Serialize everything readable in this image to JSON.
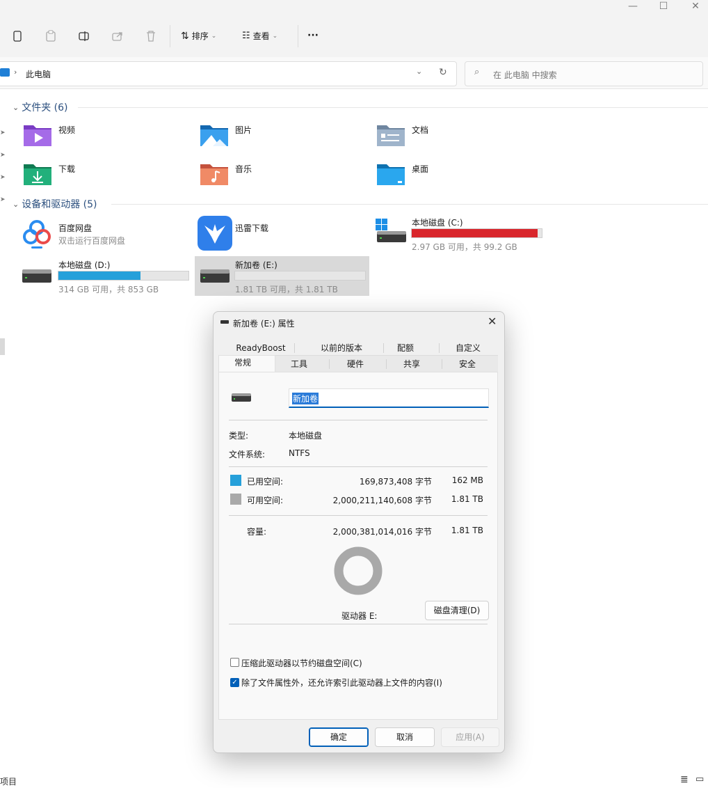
{
  "window": {
    "minimize": "—",
    "maximize": "☐",
    "close": "✕"
  },
  "toolbar": {
    "sort_label": "排序",
    "view_label": "查看",
    "more_label": "···"
  },
  "address": {
    "path": "此电脑",
    "search_placeholder": "在 此电脑 中搜索"
  },
  "folders": {
    "header": "文件夹 (6)",
    "items": [
      {
        "label": "视频",
        "icon": "videos-folder-icon",
        "color": "#8c4fd6"
      },
      {
        "label": "图片",
        "icon": "pictures-folder-icon",
        "color": "#1f86d6"
      },
      {
        "label": "文档",
        "icon": "documents-folder-icon",
        "color": "#7a93ad"
      },
      {
        "label": "下载",
        "icon": "downloads-folder-icon",
        "color": "#1d9b6c"
      },
      {
        "label": "音乐",
        "icon": "music-folder-icon",
        "color": "#e0674f"
      },
      {
        "label": "桌面",
        "icon": "desktop-folder-icon",
        "color": "#1795d6"
      }
    ]
  },
  "devices": {
    "header": "设备和驱动器 (5)",
    "baidu": {
      "label": "百度网盘",
      "sub": "双击运行百度网盘"
    },
    "xunlei": {
      "label": "迅雷下载"
    },
    "drive_c": {
      "label": "本地磁盘 (C:)",
      "sub": "2.97 GB 可用，共 99.2 GB",
      "used_fraction": 0.97,
      "bar_color": "#d9262c"
    },
    "drive_d": {
      "label": "本地磁盘 (D:)",
      "sub": "314 GB 可用，共 853 GB",
      "used_fraction": 0.63,
      "bar_color": "#26a0da"
    },
    "drive_e": {
      "label": "新加卷 (E:)",
      "sub": "1.81 TB 可用，共 1.81 TB",
      "used_fraction": 0.0,
      "bar_color": "#26a0da"
    }
  },
  "dialog": {
    "title": "新加卷 (E:) 属性",
    "tabs_row1": [
      "ReadyBoost",
      "以前的版本",
      "配额",
      "自定义"
    ],
    "tabs_row2": [
      "常规",
      "工具",
      "硬件",
      "共享",
      "安全"
    ],
    "active_tab": "常规",
    "name_value": "新加卷",
    "type_label": "类型:",
    "type_value": "本地磁盘",
    "fs_label": "文件系统:",
    "fs_value": "NTFS",
    "used_label": "已用空间:",
    "used_bytes": "169,873,408 字节",
    "used_size": "162 MB",
    "used_color": "#26a0da",
    "free_label": "可用空间:",
    "free_bytes": "2,000,211,140,608 字节",
    "free_size": "1.81 TB",
    "free_color": "#a9a9a9",
    "cap_label": "容量:",
    "cap_bytes": "2,000,381,014,016 字节",
    "cap_size": "1.81 TB",
    "drive_label": "驱动器 E:",
    "cleanup_button": "磁盘清理(D)",
    "compress_label": "压缩此驱动器以节约磁盘空间(C)",
    "compress_checked": false,
    "index_label": "除了文件属性外，还允许索引此驱动器上文件的内容(I)",
    "index_checked": true,
    "ok_button": "确定",
    "cancel_button": "取消",
    "apply_button": "应用(A)",
    "used_fraction": 0.0001
  },
  "statusbar": {
    "left": "项目"
  }
}
